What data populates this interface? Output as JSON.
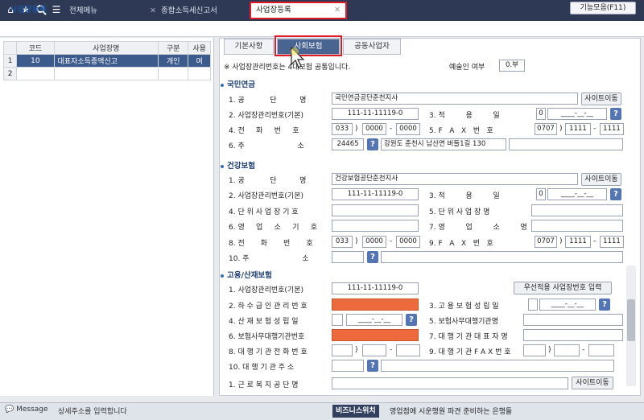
{
  "topbar": {
    "home_icon": "home-icon",
    "star_icon": "star-icon",
    "search_icon": "search-icon",
    "menu_icon": "menu-icon",
    "tabs": [
      {
        "label": "전체메뉴"
      },
      {
        "label": "종합소득세신고서"
      },
      {
        "label": "사업장등록"
      }
    ],
    "close_glyph": "✕"
  },
  "page": {
    "title": "사업장등록",
    "func_button": "기능모음(F11)"
  },
  "grid": {
    "headers": [
      "코드",
      "사업장명",
      "구분",
      "사용"
    ],
    "rows": [
      {
        "no": "1",
        "code": "10",
        "name": "대표자소득종액신고",
        "type": "개인",
        "use": "여"
      },
      {
        "no": "2",
        "code": "",
        "name": "",
        "type": "",
        "use": ""
      }
    ]
  },
  "subtabs": [
    "기본사항",
    "사회보험",
    "공동사업자"
  ],
  "notice": "※ 사업장관리번호는 4대보험 공통입니다.",
  "tax_office": {
    "label": "예술인 여부",
    "value": "0.부"
  },
  "pension": {
    "title": "국민연금",
    "r1": {
      "label": "1. 공           단          명",
      "value": "국민연금공단춘천지사",
      "btn": "사이트이동"
    },
    "r2": {
      "label": "2. 사업장관리번호(기본)",
      "value": "111-11-11119-0",
      "label2": "3. 적         용         일",
      "v2a": "0",
      "v2b": "____-__-__"
    },
    "r3": {
      "label": "4. 전     화     번     호",
      "a": "033",
      "b": "0000",
      "c": "0000",
      "label2": "5. F   A   X   번   호",
      "fa": "0707",
      "fb": "1111",
      "fc": "1111"
    },
    "r4": {
      "label": "6. 주                       소",
      "zip": "24465",
      "addr": "강원도 춘천시 남산면 버들1길 130",
      "addr2": ""
    }
  },
  "health": {
    "title": "건강보험",
    "r1": {
      "label": "1. 공           단          명",
      "value": "건강보험공단춘천지사",
      "btn": "사이트이동"
    },
    "r2": {
      "label": "2. 사업장관리번호(기본)",
      "value": "111-11-11119-0",
      "label2": "3. 적         용         일",
      "v2a": "0",
      "v2b": "____-__-__"
    },
    "r3": {
      "label": "4. 단 위 사 업 장 기 호",
      "label2": "5. 단 위 사 업 장 명"
    },
    "r4": {
      "label": "6. 영     업     소     기     호",
      "label2": "7. 영         업         소         명"
    },
    "r5": {
      "label": "8. 전       화       번       호",
      "a": "033",
      "b": "0000",
      "c": "0000",
      "label2": "9. F   A   X   번   호",
      "fa": "0707",
      "fb": "1111",
      "fc": "1111"
    },
    "r6": {
      "label": "10. 주                       소"
    }
  },
  "employment": {
    "title": "고용/산재보험",
    "r1": {
      "label": "1. 사업장관리번호(기본)",
      "value": "111-11-11119-0",
      "btn": "우선적용 사업장번호 입력"
    },
    "r2": {
      "label": "2. 하 수 급 인 관 리 번 호",
      "label2": "3. 고 용 보 험 성 립 일",
      "v2b": "____-__-__"
    },
    "r3": {
      "label": "4. 산 재 보 험 성 립 일",
      "v": "____-__-__",
      "label2": "5. 보험사무대행기관명"
    },
    "r4": {
      "label": "6. 보험사무대행기관번호",
      "label2": "7. 대 행 기 관 대 표 자 명"
    },
    "r5": {
      "label": "8. 대 행 기 관 전 화 번 호",
      "label2": "9. 대 행 기 관 F A X 번 호"
    },
    "r6": {
      "label": "10. 대 행 기 관 주 소"
    }
  },
  "welfare": {
    "label": "1. 근 로 복 지 공 단 명",
    "btn": "사이트이동"
  },
  "statusbar": {
    "message_label": "Message",
    "message": "상세주소를 입력합니다",
    "biz_label": "비즈니스위치",
    "news": "영업점에 시운행원 파견 준비하는 은행들"
  },
  "colors": {
    "accent": "#4a6492",
    "highlight": "#e01b24",
    "required": "#ec6a3b",
    "topbar": "#2e3a55"
  }
}
